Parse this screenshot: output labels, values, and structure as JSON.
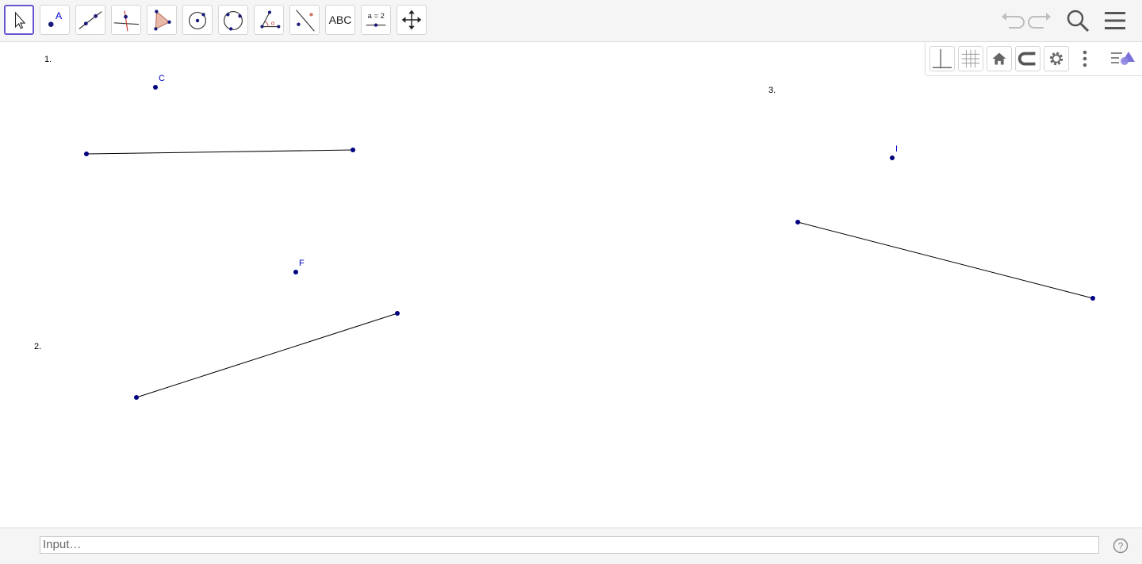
{
  "toolbar": {
    "tools": [
      {
        "name": "move-tool",
        "icon": "arrow-pointer-icon",
        "selected": true
      },
      {
        "name": "point-tool",
        "icon": "point-icon",
        "label": "A"
      },
      {
        "name": "line-tool",
        "icon": "line-icon"
      },
      {
        "name": "perpendicular-line-tool",
        "icon": "perpendicular-icon"
      },
      {
        "name": "polygon-tool",
        "icon": "polygon-icon"
      },
      {
        "name": "circle-tool",
        "icon": "circle-center-icon"
      },
      {
        "name": "circle-three-points-tool",
        "icon": "circle-three-points-icon"
      },
      {
        "name": "angle-tool",
        "icon": "angle-icon",
        "label": "α"
      },
      {
        "name": "reflect-tool",
        "icon": "reflect-icon"
      },
      {
        "name": "text-tool",
        "icon": "text-icon",
        "label": "ABC"
      },
      {
        "name": "slider-tool",
        "icon": "slider-icon",
        "label": "a = 2"
      },
      {
        "name": "move-view-tool",
        "icon": "move-arrows-icon"
      }
    ],
    "right": [
      "undo-icon",
      "redo-icon",
      "search-icon",
      "hamburger-menu-icon"
    ]
  },
  "style_bar": [
    "axes-icon",
    "grid-icon",
    "home-icon",
    "snap-icon",
    "settings-icon",
    "more-vertical-icon",
    "style-bar-toggle-icon"
  ],
  "canvas": {
    "labels": [
      {
        "name": "label-1",
        "text": "1."
      },
      {
        "name": "label-2",
        "text": "2."
      },
      {
        "name": "label-3",
        "text": "3."
      }
    ],
    "points": [
      {
        "name": "point-C",
        "text": "C"
      },
      {
        "name": "point-F",
        "text": "F"
      },
      {
        "name": "point-I",
        "text": "I"
      }
    ],
    "point_color": "#000080",
    "label_color": "#0000cc"
  },
  "input_bar": {
    "placeholder": "Input…"
  },
  "colors": {
    "accent": "#6557d2",
    "toolbar_bg": "#f5f5f5"
  }
}
